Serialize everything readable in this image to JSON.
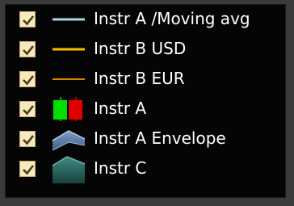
{
  "legend": {
    "items": [
      {
        "label": "Instr A /Moving avg",
        "checked": true,
        "icon": "line-icon",
        "color": "#a6d6ea"
      },
      {
        "label": "Instr B USD",
        "checked": true,
        "icon": "line-icon",
        "color": "#f2c200"
      },
      {
        "label": "Instr B EUR",
        "checked": true,
        "icon": "line-icon",
        "color": "#d68300"
      },
      {
        "label": "Instr A",
        "checked": true,
        "icon": "candlestick-icon",
        "colors": [
          "#00e000",
          "#e00000"
        ]
      },
      {
        "label": "Instr A Envelope",
        "checked": true,
        "icon": "envelope-area-icon",
        "color": "#5c7fa8"
      },
      {
        "label": "Instr C",
        "checked": true,
        "icon": "area-icon",
        "color": "#2f6e6a"
      }
    ]
  }
}
